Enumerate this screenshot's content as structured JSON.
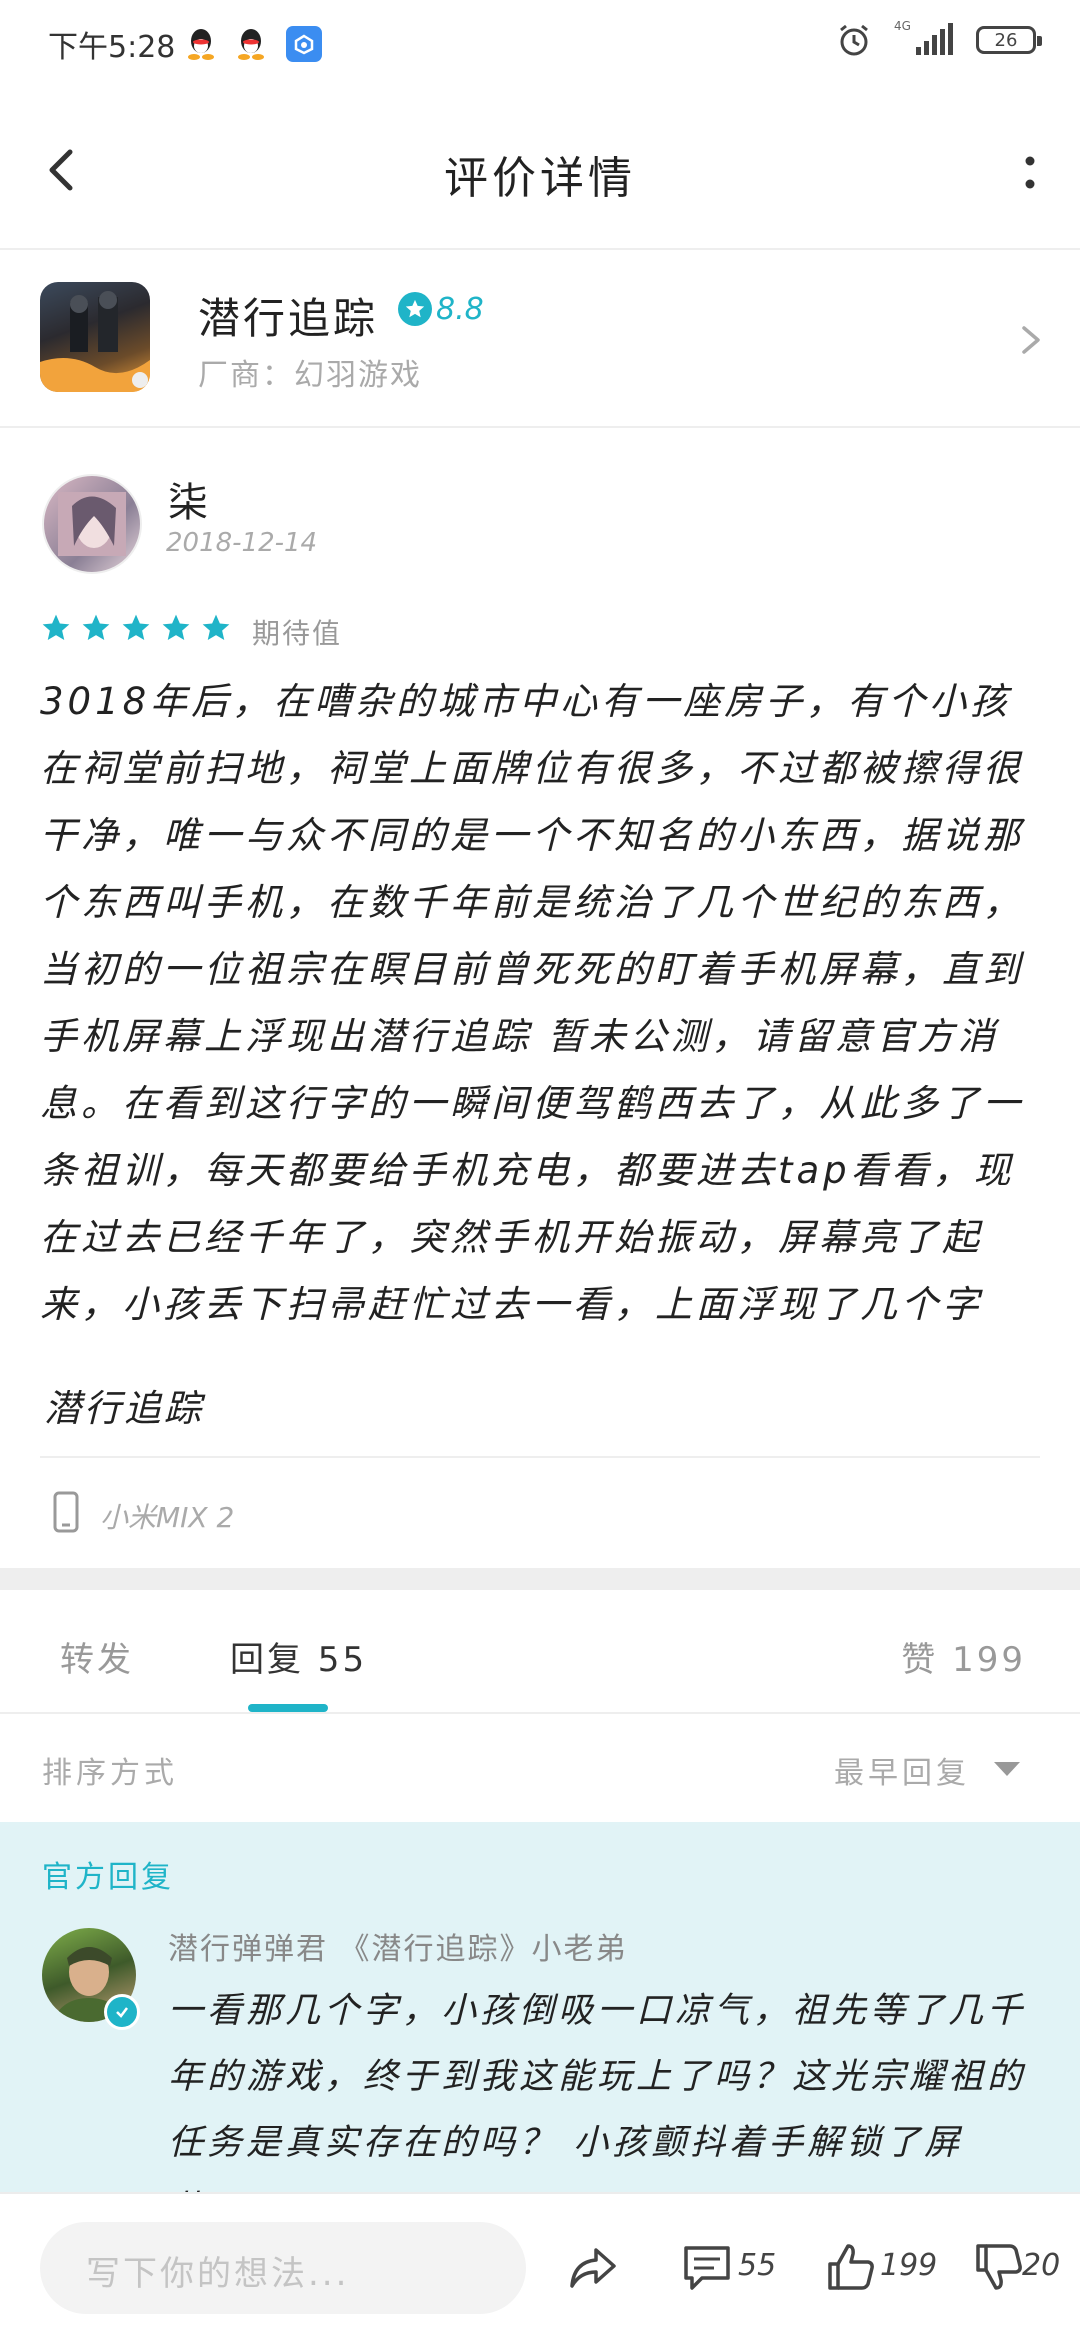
{
  "status_bar": {
    "time": "下午5:28",
    "network": "4G",
    "battery": "26"
  },
  "header": {
    "title": "评价详情"
  },
  "game": {
    "name": "潜行追踪",
    "rating": "8.8",
    "vendor": "厂商：幻羽游戏"
  },
  "review": {
    "username": "柒",
    "date": "2018-12-14",
    "star_count": 5,
    "rating_label": "期待值",
    "body": "3018年后，在嘈杂的城市中心有一座房子，有个小孩在祠堂前扫地，祠堂上面牌位有很多，不过都被擦得很干净，唯一与众不同的是一个不知名的小东西，据说那个东西叫手机，在数千年前是统治了几个世纪的东西，当初的一位祖宗在瞑目前曾死死的盯着手机屏幕，直到手机屏幕上浮现出潜行追踪 暂未公测，请留意官方消息。在看到这行字的一瞬间便驾鹤西去了，从此多了一条祖训，每天都要给手机充电，都要进去tap看看，现在过去已经千年了，突然手机开始振动，屏幕亮了起来，小孩丢下扫帚赶忙过去一看，上面浮现了几个字",
    "game_tag": "潜行追踪",
    "device": "小米MIX 2"
  },
  "tabs": [
    {
      "label": "转发"
    },
    {
      "label": "回复 55"
    },
    {
      "label": "赞 199"
    }
  ],
  "sort": {
    "label": "排序方式",
    "value": "最早回复"
  },
  "official_reply": {
    "title": "官方回复",
    "name": "潜行弹弹君 《潜行追踪》小老弟",
    "text": "一看那几个字，小孩倒吸一口凉气，祖先等了几千年的游戏，终于到我这能玩上了吗？这光宗耀祖的任务是真实存在的吗？ 小孩颤抖着手解锁了屏幕，"
  },
  "bottom_bar": {
    "input_placeholder": "写下你的想法...",
    "comment_count": "55",
    "like_count": "199",
    "dislike_count": "20"
  },
  "colors": {
    "accent": "#1fb4c8",
    "official_bg": "#e1f3f6"
  }
}
